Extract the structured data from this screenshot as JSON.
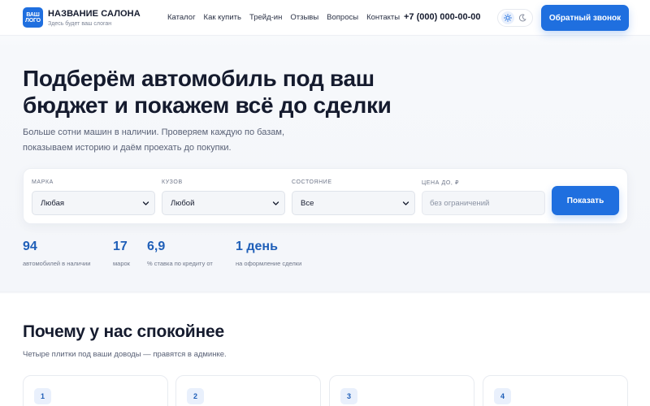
{
  "header": {
    "logo_line1": "ВАШ",
    "logo_line2": "ЛОГО",
    "brand_name": "НАЗВАНИЕ САЛОНА",
    "slogan": "Здесь будет ваш слоган",
    "nav": [
      "Каталог",
      "Как купить",
      "Трейд-ин",
      "Отзывы",
      "Вопросы",
      "Контакты"
    ],
    "phone": "+7 (000) 000-00-00",
    "theme_icons": [
      "sun-icon",
      "moon-icon"
    ],
    "callback_label": "Обратный звонок"
  },
  "hero": {
    "title_line1": "Подберём автомобиль под ваш",
    "title_line2": "бюджет и покажем всё до сделки",
    "subtitle_line1": "Больше сотни машин в наличии. Проверяем каждую по базам,",
    "subtitle_line2": "показываем историю и даём проехать до покупки."
  },
  "filter": {
    "brand_label": "МАРКА",
    "brand_value": "Любая",
    "body_label": "КУЗОВ",
    "body_value": "Любой",
    "condition_label": "СОСТОЯНИЕ",
    "condition_value": "Все",
    "price_label": "ЦЕНА ДО, ₽",
    "price_placeholder": "без ограничений",
    "submit_label": "Показать"
  },
  "stats": [
    {
      "value": "94",
      "label": "автомобилей в наличии"
    },
    {
      "value": "17",
      "label": "марок"
    },
    {
      "value": "6,9",
      "label": "% ставка по кредиту от"
    },
    {
      "value": "1 день",
      "label": "на оформление сделки"
    }
  ],
  "why": {
    "title": "Почему у нас спокойнее",
    "subtitle": "Четыре плитки под ваши доводы — правятся в админке.",
    "tiles": [
      "1",
      "2",
      "3",
      "4"
    ]
  },
  "colors": {
    "accent": "#1f6fdf",
    "stat_value": "#1f5fb8",
    "text": "#151b2e",
    "muted": "#596176"
  }
}
